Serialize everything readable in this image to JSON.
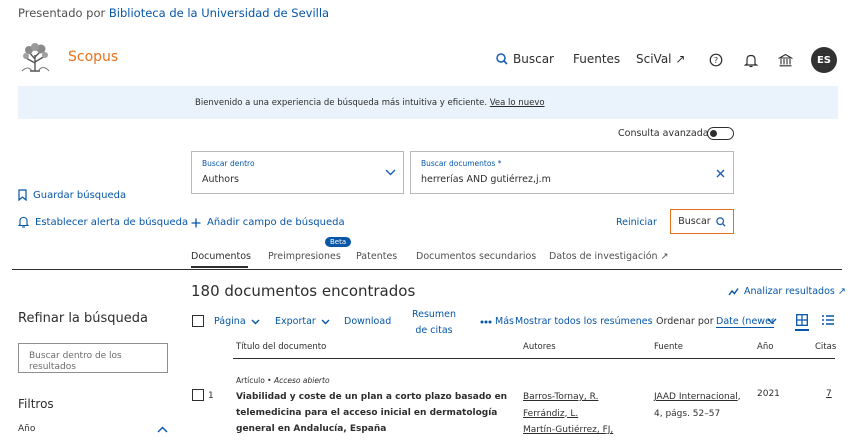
{
  "presented_by": {
    "prefix": "Presentado por",
    "institution": "Biblioteca de la Universidad de Sevilla"
  },
  "brand": {
    "name": "Scopus",
    "accent": "#e9711c"
  },
  "header": {
    "search": "Buscar",
    "sources": "Fuentes",
    "scival": "SciVal ↗",
    "avatar": "ES"
  },
  "banner": {
    "text": "Bienvenido a una experiencia de búsqueda más intuitiva y eficiente.",
    "link": "Vea lo nuevo"
  },
  "advanced": {
    "label": "Consulta avanzada"
  },
  "sidebar": {
    "save_search": "Guardar búsqueda",
    "set_alert": "Establecer alerta de búsqueda"
  },
  "search_form": {
    "within_label": "Buscar dentro",
    "within_value": "Authors",
    "docs_label": "Buscar documentos *",
    "docs_value": "herrerías AND gutiérrez,j.m",
    "add_field": "Añadir campo de búsqueda",
    "reset": "Reiniciar",
    "submit": "Buscar"
  },
  "tabs": [
    {
      "label": "Documentos",
      "active": true
    },
    {
      "label": "Preimpresiones",
      "badge": "Beta"
    },
    {
      "label": "Patentes"
    },
    {
      "label": "Documentos secundarios"
    },
    {
      "label": "Datos de investigación ↗"
    }
  ],
  "results": {
    "count": "180 documentos encontrados",
    "analyze": "Analizar resultados ↗"
  },
  "refine": {
    "title": "Refinar la búsqueda",
    "filter_placeholder": "Buscar dentro de los resultados",
    "filters_title": "Filtros",
    "year_facet": "Año"
  },
  "toolbar": {
    "page": "Página",
    "export": "Exportar",
    "download": "Download",
    "citation_overview": "Resumen de citas",
    "more": "Más",
    "show_abstracts": "Mostrar todos los resúmenes",
    "sort_label": "Ordenar por",
    "sort_value": "Date (newest)"
  },
  "table": {
    "headers": {
      "title": "Título del documento",
      "authors": "Autores",
      "source": "Fuente",
      "year": "Año",
      "cites": "Citas"
    },
    "rows": [
      {
        "index": "1",
        "type": "Artículo",
        "access": "Acceso abierto",
        "title": "Viabilidad y coste de un plan a corto plazo basado en telemedicina para el acceso inicial en dermatología general en Andalucía, España",
        "authors": [
          "Barros-Tornay, R.",
          "Ferrándiz, L.",
          "Martín-Gutiérrez, FJ,"
        ],
        "source": "JAAD Internacional",
        "source_pages": "4, págs. 52–57",
        "year": "2021",
        "cites": "7"
      }
    ]
  }
}
